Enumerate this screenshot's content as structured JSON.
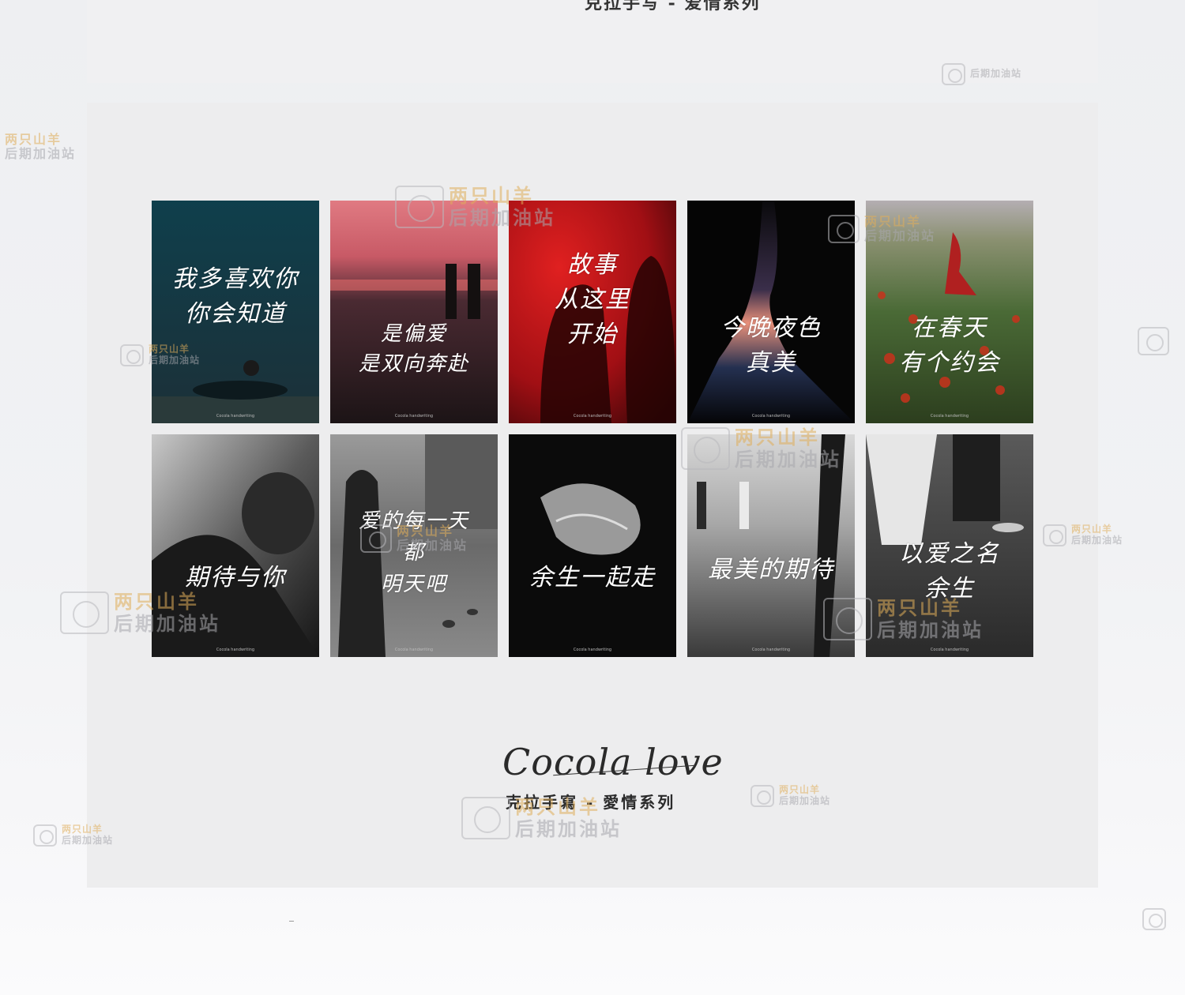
{
  "header": {
    "cut_title": "克拉手写 - 爱情系列"
  },
  "cards": [
    {
      "text": "我多喜欢你\n你会知道",
      "theme": "teal"
    },
    {
      "text": "是偏爱\n是双向奔赴",
      "theme": "sunset"
    },
    {
      "text": "故事\n从这里\n开始",
      "theme": "red"
    },
    {
      "text": "今晚夜色\n真美",
      "theme": "silhouette"
    },
    {
      "text": "在春天\n有个约会",
      "theme": "field"
    },
    {
      "text": "期待与你",
      "theme": "bw-hug"
    },
    {
      "text": "爱的每一天\n都\n明天吧",
      "theme": "bw-street"
    },
    {
      "text": "余生一起走",
      "theme": "bw-hands"
    },
    {
      "text": "最美的期待",
      "theme": "bw-walk"
    },
    {
      "text": "以爱之名\n余生",
      "theme": "bw-feet"
    }
  ],
  "card_signature": "Cocola handwriting",
  "brand": {
    "script": "Cocola love",
    "series": "克拉手寫 - 愛情系列"
  },
  "watermark": {
    "line1": "两只山羊",
    "line2": "后期加油站",
    "line1_color": "#e0ae5a",
    "line2_color": "#a8a8ad"
  },
  "colors": {
    "panel": "#ededee",
    "page": "#f1f2f4"
  }
}
